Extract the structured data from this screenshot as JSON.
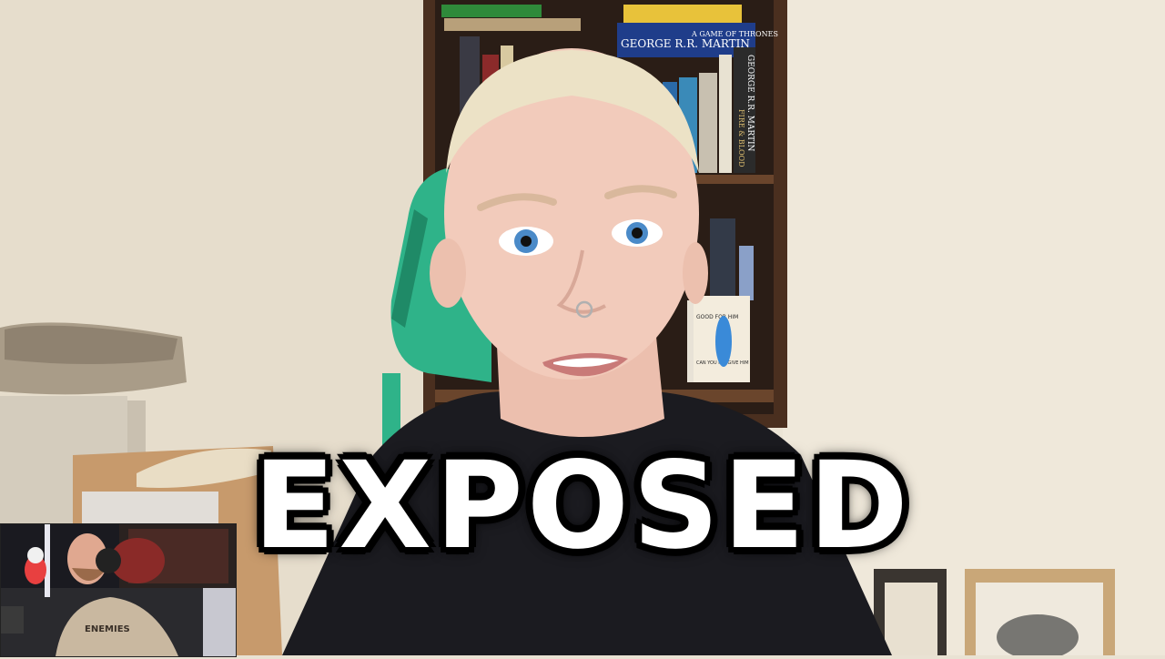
{
  "overlay": {
    "caption": "EXPOSED"
  },
  "books": {
    "spine_1": "GEORGE R.R. MARTIN",
    "spine_2": "A GAME OF THRONES",
    "spine_3": "GEORGE R.R. MARTIN",
    "spine_4": "FIRE & BLOOD",
    "cover_1": "GOOD FOR HIM",
    "cover_2": "CAN YOU FORGIVE HIM"
  },
  "pip_shirt_text": "ENEMIES",
  "colors": {
    "wall": "#e9e2d3",
    "shelf": "#5a3a26",
    "chair": "#2fb389",
    "shirt": "#1a1a1f",
    "skin": "#f1c9b8",
    "caption_fill": "#ffffff",
    "caption_stroke": "#000000"
  }
}
